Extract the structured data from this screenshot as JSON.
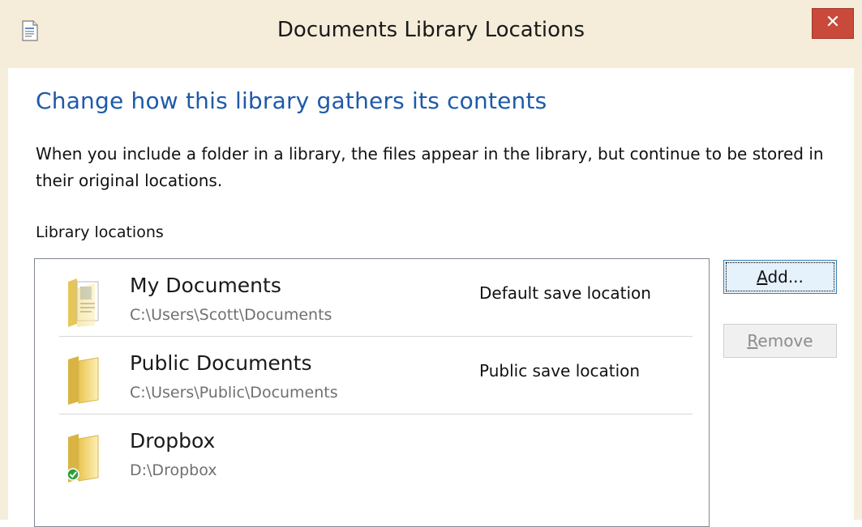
{
  "window": {
    "title": "Documents Library Locations",
    "close_glyph": "✕",
    "icon": "document-icon"
  },
  "content": {
    "heading": "Change how this library gathers its contents",
    "description": "When you include a folder in a library, the files appear in the library, but continue to be stored in their original locations.",
    "locations_label": "Library locations"
  },
  "locations": [
    {
      "name": "My Documents",
      "path": "C:\\Users\\Scott\\Documents",
      "tag": "Default save location",
      "icon": "documents-folder-icon"
    },
    {
      "name": "Public Documents",
      "path": "C:\\Users\\Public\\Documents",
      "tag": "Public save location",
      "icon": "folder-icon"
    },
    {
      "name": "Dropbox",
      "path": "D:\\Dropbox",
      "tag": "",
      "icon": "synced-folder-icon"
    }
  ],
  "buttons": {
    "add_mnemonic": "A",
    "add_rest": "dd...",
    "remove_mnemonic": "R",
    "remove_rest": "emove"
  },
  "colors": {
    "heading": "#1e5aa8",
    "close": "#c94a3a",
    "frame": "#f5ecda"
  }
}
